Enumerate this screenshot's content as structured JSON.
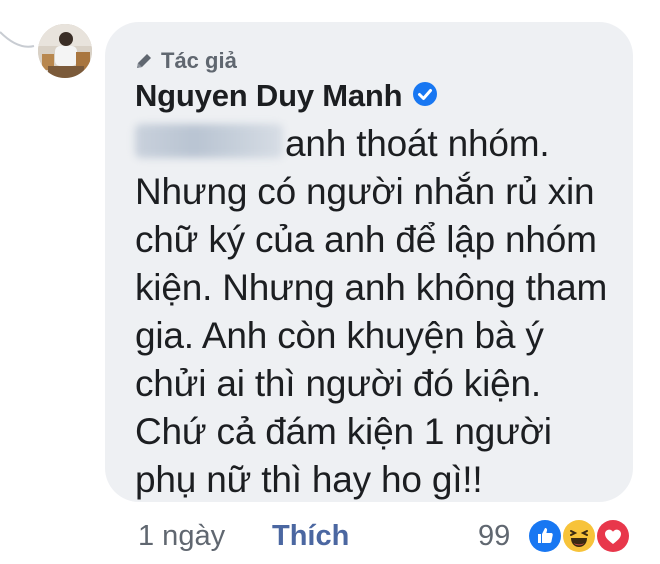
{
  "comment": {
    "author_tag": "Tác giả",
    "author_name": "Nguyen Duy Manh",
    "lines": [
      "anh thoát nhóm.",
      "Nhưng có người nhắn rủ xin",
      "chữ ký của anh để lập nhóm",
      "kiện. Nhưng anh không tham",
      "gia. Anh còn khuyện bà ý",
      "chửi ai thì người đó kiện.",
      "Chứ cả đám kiện 1 người",
      "phụ nữ thì hay ho gì!!"
    ]
  },
  "footer": {
    "time": "1 ngày",
    "like_label": "Thích",
    "reaction_count": "99"
  },
  "icons": {
    "author_tag_icon": "pencil-icon",
    "verified_icon": "verified-badge-icon",
    "reactions": [
      "like-reaction-icon",
      "haha-reaction-icon",
      "love-reaction-icon"
    ]
  },
  "colors": {
    "bubble_bg": "#eef0f3",
    "like_link": "#4b67a1",
    "verified": "#1877f2",
    "muted_text": "#606770"
  }
}
